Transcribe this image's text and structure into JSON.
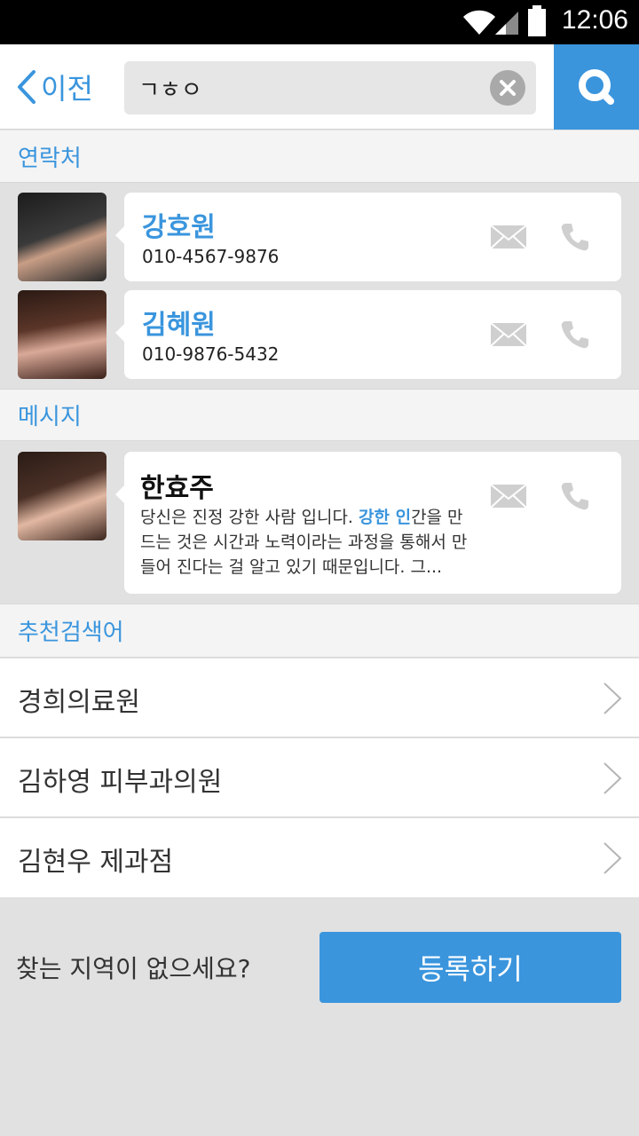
{
  "status_bar": {
    "time": "12:06"
  },
  "header": {
    "back_label": "이전",
    "search_value": "ㄱㅎㅇ"
  },
  "sections": {
    "contacts": "연락처",
    "messages": "메시지",
    "suggestions": "추천검색어"
  },
  "contacts": [
    {
      "name": "강호원",
      "phone": "010-4567-9876"
    },
    {
      "name": "김혜원",
      "phone": "010-9876-5432"
    }
  ],
  "message": {
    "sender": "한효주",
    "text_before": "당신은 진정 강한 사람 입니다. ",
    "text_highlight": "강한 인",
    "text_after": "간을 만드는 것은 시간과 노력이라는 과정을 통해서 만들어 진다는 걸 알고 있기 때문입니다. 그..."
  },
  "suggestions": [
    {
      "label": "경희의료원"
    },
    {
      "label": "김하영 피부과의원"
    },
    {
      "label": "김현우 제과점"
    }
  ],
  "footer": {
    "question": "찾는 지역이 없으세요?",
    "register_label": "등록하기"
  },
  "colors": {
    "accent": "#3a95dd",
    "background": "#e1e1e1",
    "section_bg": "#f4f4f4"
  },
  "icons": [
    "wifi-icon",
    "signal-icon",
    "battery-icon",
    "back-chevron-icon",
    "clear-icon",
    "search-icon",
    "mail-icon",
    "phone-icon",
    "chevron-right-icon"
  ]
}
